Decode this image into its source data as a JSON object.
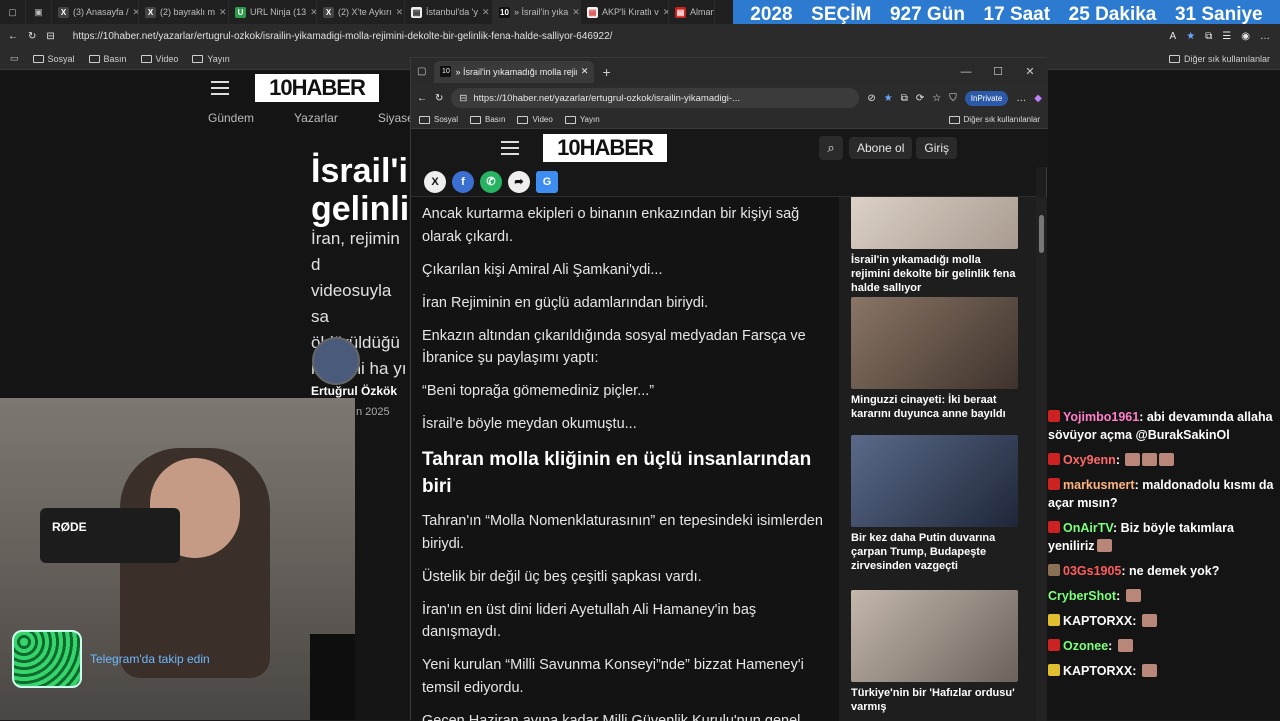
{
  "countdown": {
    "year": "2028",
    "label": "SEÇİM",
    "days": "927 Gün",
    "hours": "17 Saat",
    "minutes": "25 Dakika",
    "seconds": "31 Saniye",
    "bg_color": "#2c7bd0"
  },
  "bg_browser": {
    "tabs": [
      {
        "icon": "x-icon",
        "title": "(3) Anasayfa /"
      },
      {
        "icon": "x-icon",
        "title": "(2) bayraklı m"
      },
      {
        "icon": "urlninja-icon",
        "title": "URL Ninja (13"
      },
      {
        "icon": "x-icon",
        "title": "(2) X'te Aykırı"
      },
      {
        "icon": "news-icon",
        "title": "İstanbul'da 'y"
      },
      {
        "icon": "10haber-icon",
        "title": "» İsrail'in yıka"
      },
      {
        "icon": "news-icon",
        "title": "AKP'li Kıratlı v"
      },
      {
        "icon": "news-icon",
        "title": "Alman"
      }
    ],
    "url": "https://10haber.net/yazarlar/ertugrul-ozkok/israilin-yikamadigi-molla-rejimini-dekolte-bir-gelinlik-fena-halde-salliyor-646922/",
    "bookmarks": [
      "Sosyal",
      "Basın",
      "Video",
      "Yayın"
    ],
    "other_bookmarks": "Diğer sık kullanılanlar"
  },
  "bg_page": {
    "logo": "10HABER",
    "nav": [
      "Gündem",
      "Yazarlar",
      "Siyaset"
    ],
    "title_lines": [
      "İsrail'in",
      "gelinlik"
    ],
    "summary_lines": [
      "İran, rejimin d",
      "videosuyla sa",
      "öldürüldüğü",
      "rejimini ha yı"
    ],
    "author": "Ertuğrul Özkök",
    "date": "n 2025"
  },
  "webcam": {
    "mic_brand": "RØDE",
    "telegram": "Telegram'da takip edin"
  },
  "fg_browser": {
    "tab_title": "» İsrail'in yıkamadığı molla rejimi",
    "url": "https://10haber.net/yazarlar/ertugrul-ozkok/israilin-yikamadigi-...",
    "inprivate": "InPrivate",
    "bookmarks": [
      "Sosyal",
      "Basın",
      "Video",
      "Yayın"
    ],
    "other_bookmarks": "Diğer sık kullanılanlar"
  },
  "site": {
    "logo": "10HABER",
    "subscribe": "Abone ol",
    "login": "Giriş"
  },
  "share": [
    "x-icon",
    "facebook-icon",
    "whatsapp-icon",
    "share-icon",
    "google-news-icon"
  ],
  "article": {
    "p1": "Ancak kurtarma ekipleri o binanın enkazından bir kişiyi sağ olarak çıkardı.",
    "p2": "Çıkarılan kişi Amiral Ali Şamkani'ydi...",
    "p3": "İran Rejiminin en güçlü adamlarından biriydi.",
    "p4": "Enkazın altından çıkarıldığında sosyal medyadan Farsça ve İbranice şu paylaşımı yaptı:",
    "p5": "“Beni toprağa gömemediniz piçler...”",
    "p6": "İsrail'e böyle meydan okumuştu...",
    "h2": "Tahran molla kliğinin en üçlü insanlarından biri",
    "p7": "Tahran'ın “Molla Nomenklaturasının” en tepesindeki isimlerden biriydi.",
    "p8": "Üstelik bir değil üç beş çeşitli şapkası vardı.",
    "p9": "İran'ın en üst dini lideri Ayetullah Ali Hamaney'in baş danışmaydı.",
    "p10": "Yeni kurulan “Milli Savunma Konseyi”nde” bizzat Hameney'i temsil ediyordu.",
    "p11": "Geçen Haziran ayına kadar Milli Güvenlik Kurulu'nun genel"
  },
  "sidebar": [
    {
      "caption": "İsrail'in yıkamadığı molla rejimini dekolte bir gelinlik fena halde sallıyor",
      "img_color": "#d9cfc6"
    },
    {
      "caption": "Minguzzi cinayeti: İki beraat kararını duyunca anne bayıldı",
      "img_color": "#6b5a4e"
    },
    {
      "caption": "Bir kez daha Putin duvarına çarpan Trump, Budapeşte zirvesinden vazgeçti",
      "img_color": "#3c4a6a"
    },
    {
      "caption": "Türkiye'nin bir 'Hafızlar ordusu' varmış",
      "img_color": "#9a8f86"
    }
  ],
  "chat": [
    {
      "user": "Yojimbo1961",
      "color": "#ff80c8",
      "text": "abi devamında allaha sövüyor açma @BurakSakinOl",
      "badge": "#cc2222"
    },
    {
      "user": "Oxy9enn",
      "color": "#ff6a6a",
      "text": "",
      "badge": "#cc2222",
      "emotes": 3
    },
    {
      "user": "markusmert",
      "color": "#ffb380",
      "text": "maldonadolu kısmı da açar mısın?",
      "badge": "#cc2222"
    },
    {
      "user": "OnAirTV",
      "color": "#7cff7c",
      "text": "Biz böyle takımlara yeniliriz",
      "badge": "#cc2222",
      "emotes": 1
    },
    {
      "user": "03Gs1905",
      "color": "#ff5c5c",
      "text": "ne demek yok?",
      "badge": "#8a7055"
    },
    {
      "user": "CryberShot",
      "color": "#7cff7c",
      "text": "",
      "badge": "none",
      "emotes": 1
    },
    {
      "user": "KAPTORXX",
      "color": "#ffffff",
      "text": "",
      "badge": "#e0c030",
      "emotes": 1
    },
    {
      "user": "Ozonee",
      "color": "#7cff7c",
      "text": "",
      "badge": "#cc2222",
      "emotes": 1
    },
    {
      "user": "KAPTORXX",
      "color": "#ffffff",
      "text": "",
      "badge": "#e0c030",
      "emotes": 1
    }
  ]
}
